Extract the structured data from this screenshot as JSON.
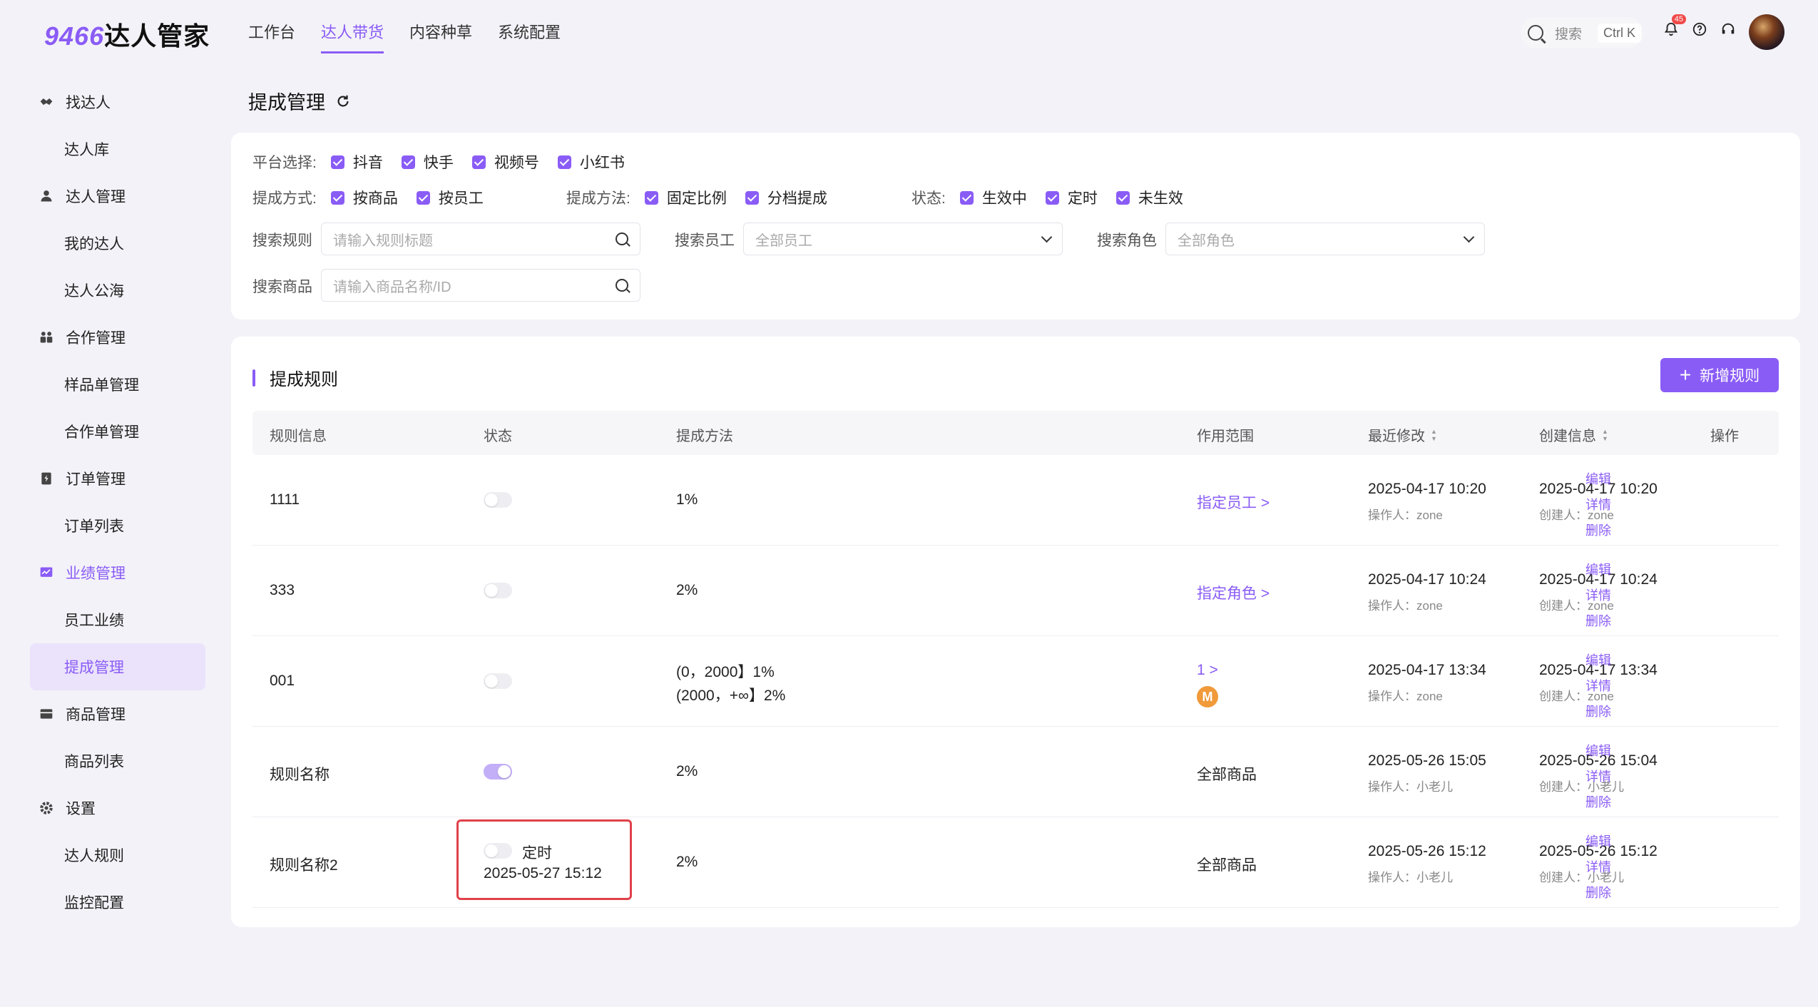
{
  "app": {
    "logo_num": "9466",
    "logo_text": "达人管家"
  },
  "topnav": [
    {
      "label": "工作台",
      "active": false
    },
    {
      "label": "达人带货",
      "active": true
    },
    {
      "label": "内容种草",
      "active": false
    },
    {
      "label": "系统配置",
      "active": false
    }
  ],
  "search": {
    "label": "搜索",
    "shortcut": "Ctrl K"
  },
  "notifications": {
    "badge": "45"
  },
  "sidebar": {
    "groups": [
      {
        "label": "找达人",
        "icon": "handshake-icon",
        "items": [
          "达人库"
        ]
      },
      {
        "label": "达人管理",
        "icon": "user-icon",
        "items": [
          "我的达人",
          "达人公海"
        ]
      },
      {
        "label": "合作管理",
        "icon": "team-icon",
        "items": [
          "样品单管理",
          "合作单管理"
        ]
      },
      {
        "label": "订单管理",
        "icon": "order-icon",
        "items": [
          "订单列表"
        ]
      },
      {
        "label": "业绩管理",
        "icon": "chart-icon",
        "items": [
          "员工业绩",
          "提成管理"
        ]
      },
      {
        "label": "商品管理",
        "icon": "box-icon",
        "items": [
          "商品列表"
        ]
      },
      {
        "label": "设置",
        "icon": "gear-icon",
        "items": [
          "达人规则",
          "监控配置"
        ]
      }
    ],
    "active_item": "提成管理"
  },
  "page": {
    "title": "提成管理"
  },
  "filters": {
    "platform_label": "平台选择:",
    "platforms": [
      "抖音",
      "快手",
      "视频号",
      "小红书"
    ],
    "mode_label": "提成方式:",
    "modes": [
      "按商品",
      "按员工"
    ],
    "method_label": "提成方法:",
    "methods": [
      "固定比例",
      "分档提成"
    ],
    "status_label": "状态:",
    "statuses": [
      "生效中",
      "定时",
      "未生效"
    ],
    "rule_label": "搜索规则",
    "rule_placeholder": "请输入规则标题",
    "employee_label": "搜索员工",
    "employee_value": "全部员工",
    "role_label": "搜索角色",
    "role_value": "全部角色",
    "product_label": "搜索商品",
    "product_placeholder": "请输入商品名称/ID"
  },
  "rules": {
    "section_title": "提成规则",
    "add_button": "新增规则",
    "columns": [
      "规则信息",
      "状态",
      "提成方法",
      "作用范围",
      "最近修改",
      "创建信息",
      "操作"
    ],
    "ops": [
      "编辑",
      "详情",
      "删除"
    ],
    "rows": [
      {
        "name": "1111",
        "toggle_on": false,
        "status_text": "",
        "status_time": "",
        "method": [
          "1%"
        ],
        "scope": "指定员工 >",
        "scope_link": true,
        "scope_coin": false,
        "modified": "2025-04-17 10:20",
        "modifier": "操作人：zone",
        "created": "2025-04-17 10:20",
        "creator": "创建人：zone"
      },
      {
        "name": "333",
        "toggle_on": false,
        "status_text": "",
        "status_time": "",
        "method": [
          "2%"
        ],
        "scope": "指定角色 >",
        "scope_link": true,
        "scope_coin": false,
        "modified": "2025-04-17 10:24",
        "modifier": "操作人：zone",
        "created": "2025-04-17 10:24",
        "creator": "创建人：zone"
      },
      {
        "name": "001",
        "toggle_on": false,
        "status_text": "",
        "status_time": "",
        "method": [
          "(0，2000】1%",
          "(2000，+∞】2%"
        ],
        "scope": "1 >",
        "scope_link": true,
        "scope_coin": true,
        "modified": "2025-04-17 13:34",
        "modifier": "操作人：zone",
        "created": "2025-04-17 13:34",
        "creator": "创建人：zone"
      },
      {
        "name": "规则名称",
        "toggle_on": true,
        "status_text": "",
        "status_time": "",
        "method": [
          "2%"
        ],
        "scope": "全部商品",
        "scope_link": false,
        "scope_coin": false,
        "modified": "2025-05-26 15:05",
        "modifier": "操作人：小老儿",
        "created": "2025-05-26 15:04",
        "creator": "创建人：小老儿"
      },
      {
        "name": "规则名称2",
        "toggle_on": false,
        "status_text": "定时",
        "status_time": "2025-05-27 15:12",
        "method": [
          "2%"
        ],
        "scope": "全部商品",
        "scope_link": false,
        "scope_coin": false,
        "modified": "2025-05-26 15:12",
        "modifier": "操作人：小老儿",
        "created": "2025-05-26 15:12",
        "creator": "创建人：小老儿"
      }
    ]
  },
  "colors": {
    "accent": "#8a5cf6",
    "highlight": "#e0414a"
  }
}
